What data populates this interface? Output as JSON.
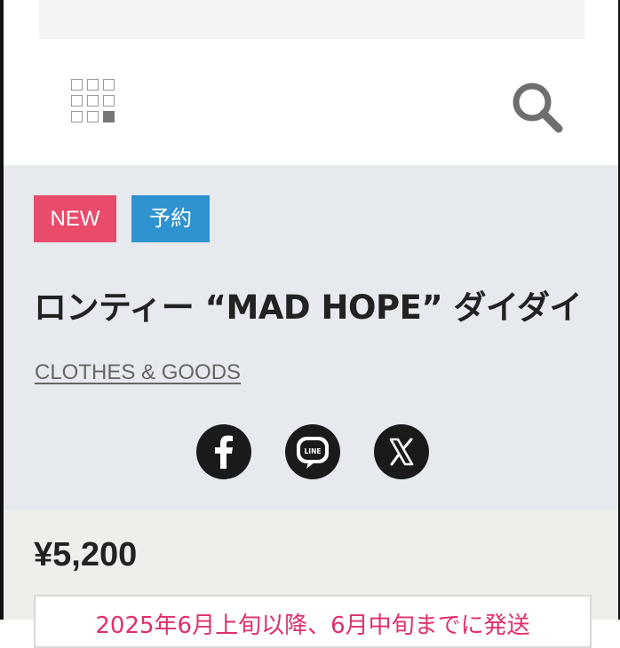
{
  "header": {
    "menu_icon": "grid-menu-icon",
    "search_icon": "search-icon"
  },
  "badges": {
    "new_label": "NEW",
    "reserve_label": "予約",
    "new_color": "#e94c6b",
    "reserve_color": "#2f93cf"
  },
  "product": {
    "title": "ロンティー “MAD HOPE” ダイダイ",
    "category": "CLOTHES & GOODS",
    "price": "¥5,200",
    "shipping_notice": "2025年6月上旬以降、6月中旬までに発送"
  },
  "share": {
    "icons": [
      "facebook-icon",
      "line-icon",
      "x-icon"
    ],
    "line_text": "LINE"
  }
}
